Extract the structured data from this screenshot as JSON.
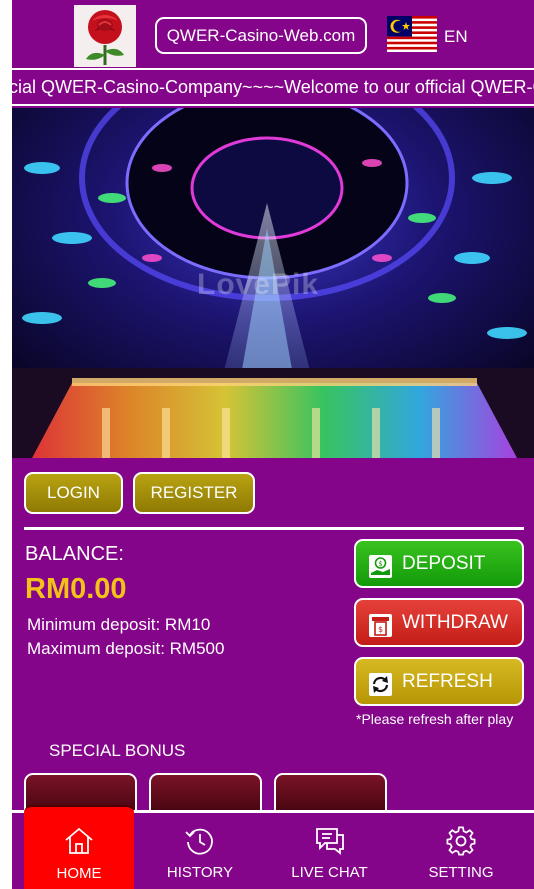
{
  "header": {
    "site_title": "QWER-Casino-Web.com",
    "language": "EN",
    "logo_icon": "rose-logo-icon",
    "flag_icon": "malaysia-flag-icon"
  },
  "marquee": {
    "text": "ficial QWER-Casino-Company~~~~Welcome to our official QWER-C"
  },
  "banner": {
    "watermark": "LovePik"
  },
  "auth": {
    "login_label": "LOGIN",
    "register_label": "REGISTER"
  },
  "wallet": {
    "balance_label": "BALANCE:",
    "balance_value": "RM0.00",
    "min_deposit": "Minimum deposit: RM10",
    "max_deposit": "Maximum deposit: RM500",
    "deposit_label": "DEPOSIT",
    "withdraw_label": "WITHDRAW",
    "refresh_label": "REFRESH",
    "refresh_note": "*Please refresh after play"
  },
  "bonus": {
    "title": "SPECIAL BONUS"
  },
  "nav": {
    "items": [
      {
        "label": "HOME",
        "icon": "home-icon"
      },
      {
        "label": "HISTORY",
        "icon": "history-icon"
      },
      {
        "label": "LIVE CHAT",
        "icon": "chat-icon"
      },
      {
        "label": "SETTING",
        "icon": "gear-icon"
      }
    ]
  },
  "colors": {
    "background": "#85058a",
    "gold_button": "#a8920b",
    "deposit": "#22ad13",
    "withdraw": "#d52d26",
    "refresh": "#c9aa12",
    "balance": "#f3c21a",
    "nav_active": "#ff0000"
  }
}
